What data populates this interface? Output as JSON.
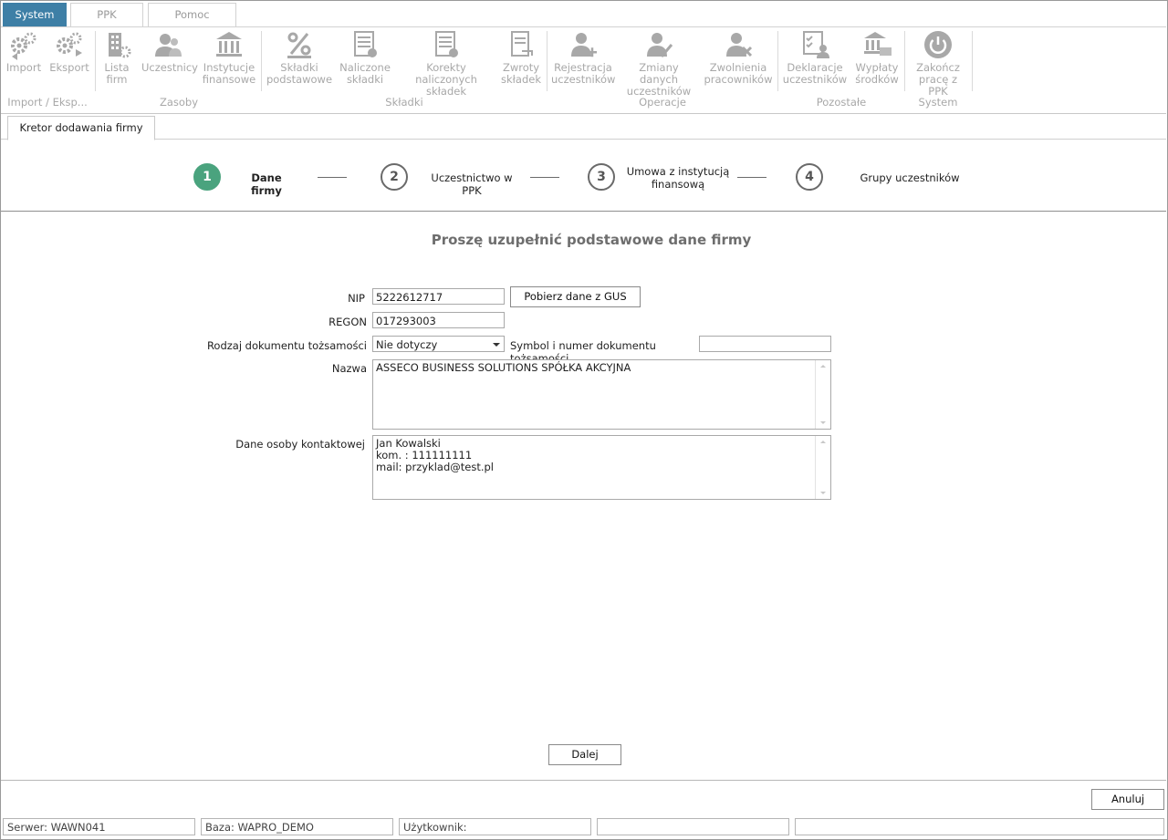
{
  "ribbon": {
    "tabs": [
      {
        "label": "System",
        "active": true
      },
      {
        "label": "PPK",
        "active": false
      },
      {
        "label": "Pomoc",
        "active": false
      }
    ],
    "buttons": {
      "import": "Import",
      "eksport": "Eksport",
      "lista_firm": [
        "Lista",
        "firm"
      ],
      "uczestnicy": "Uczestnicy",
      "instytucje": [
        "Instytucje",
        "finansowe"
      ],
      "skladki_podstawowe": [
        "Składki",
        "podstawowe"
      ],
      "naliczone_skladki": [
        "Naliczone",
        "składki"
      ],
      "korekty": [
        "Korekty naliczonych",
        "składek"
      ],
      "zwroty": [
        "Zwroty",
        "składek"
      ],
      "rejestracja": [
        "Rejestracja",
        "uczestników"
      ],
      "zmiany": [
        "Zmiany danych",
        "uczestników"
      ],
      "zwolnienia": [
        "Zwolnienia",
        "pracowników"
      ],
      "deklaracje": [
        "Deklaracje",
        "uczestników"
      ],
      "wyplaty": [
        "Wypłaty",
        "środków"
      ],
      "zakoncz": [
        "Zakończ",
        "pracę z PPK"
      ]
    },
    "groups": {
      "import_eksp": "Import / Eksp...",
      "zasoby": "Zasoby",
      "skladki": "Składki",
      "operacje": "Operacje",
      "pozostale": "Pozostałe",
      "system": "System"
    }
  },
  "doc_tab": "Kretor dodawania firmy",
  "wizard": {
    "steps": [
      {
        "number": "1",
        "label": "Dane firmy",
        "active": true
      },
      {
        "number": "2",
        "label": "Uczestnictwo w PPK",
        "active": false
      },
      {
        "number": "3",
        "label_line1": "Umowa z instytucją",
        "label_line2": "finansową",
        "active": false
      },
      {
        "number": "4",
        "label": "Grupy uczestników",
        "active": false
      }
    ]
  },
  "form": {
    "heading": "Proszę uzupełnić podstawowe dane firmy",
    "nip_label": "NIP",
    "nip_value": "5222612717",
    "gus_button": "Pobierz dane z GUS",
    "regon_label": "REGON",
    "regon_value": "017293003",
    "doc_type_label": "Rodzaj dokumentu tożsamości",
    "doc_type_value": "Nie dotyczy",
    "doc_symbol_label": "Symbol i numer dokumentu tożsamości",
    "doc_symbol_value": "",
    "nazwa_label": "Nazwa",
    "nazwa_value": "ASSECO BUSINESS SOLUTIONS SPÓŁKA AKCYJNA",
    "contact_label": "Dane osoby kontaktowej",
    "contact_lines": [
      "Jan Kowalski",
      "kom. : 111111111",
      "mail: przyklad@test.pl"
    ],
    "next_button": "Dalej"
  },
  "cancel_button": "Anuluj",
  "status": {
    "server": "Serwer: WAWN041",
    "base": "Baza: WAPRO_DEMO",
    "user": "Użytkownik:",
    "cell4": "",
    "cell5": ""
  },
  "colors": {
    "accent_tab": "#3e7fa6",
    "active_step": "#4aa37e",
    "disabled_icon": "#a8a8a8"
  }
}
